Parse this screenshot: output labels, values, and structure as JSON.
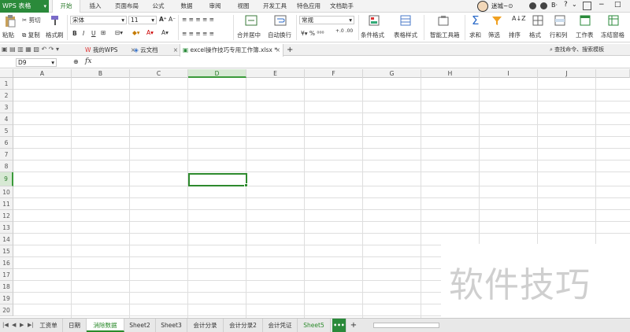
{
  "app": {
    "title": "WPS 表格"
  },
  "menu": {
    "items": [
      "开始",
      "插入",
      "页面布局",
      "公式",
      "数据",
      "审阅",
      "视图",
      "开发工具",
      "特色应用",
      "文档助手"
    ],
    "user": "迷城~⊙"
  },
  "ribbon": {
    "paste": "粘贴",
    "cut": "剪切",
    "copy": "复制",
    "format_painter": "格式刷",
    "font_name": "宋体",
    "font_size": "11",
    "merge_center": "合并居中",
    "wrap_text": "自动换行",
    "number_format": "常规",
    "conditional_format": "条件格式",
    "table_style": "表格样式",
    "smart_toolbox": "智能工具箱",
    "sum": "求和",
    "filter": "筛选",
    "sort": "排序",
    "format": "格式",
    "row_col": "行和列",
    "worksheet": "工作表",
    "freeze": "冻结窗格",
    "bold": "B",
    "italic": "I",
    "underline": "U"
  },
  "doc_tabs": {
    "my_wps": "我的WPS",
    "cloud_docs": "云文档",
    "file": "excel操作技巧专用工作簿.xlsx *",
    "search": "查找命令、搜索模板"
  },
  "formula_bar": {
    "name_box": "D9",
    "fx": "fx",
    "content": ""
  },
  "grid": {
    "columns": [
      "A",
      "B",
      "C",
      "D",
      "E",
      "F",
      "G",
      "H",
      "I",
      "J"
    ],
    "rows": [
      "1",
      "2",
      "3",
      "4",
      "5",
      "6",
      "7",
      "8",
      "9",
      "10",
      "11",
      "12",
      "13",
      "14",
      "15",
      "16",
      "17",
      "18",
      "19",
      "20"
    ],
    "selected_column": "D",
    "selected_row": "9"
  },
  "watermark": {
    "text": "软件技巧"
  },
  "sheets": {
    "tabs": [
      "工资单",
      "日期",
      "消除数据",
      "Sheet2",
      "Sheet3",
      "会计分录",
      "会计分录2",
      "会计凭证",
      "Sheet5"
    ],
    "active": "消除数据",
    "more": "•••",
    "add": "+"
  },
  "colors": {
    "accent_green": "#2a8a3a",
    "selection_green": "#2e8a2e"
  }
}
